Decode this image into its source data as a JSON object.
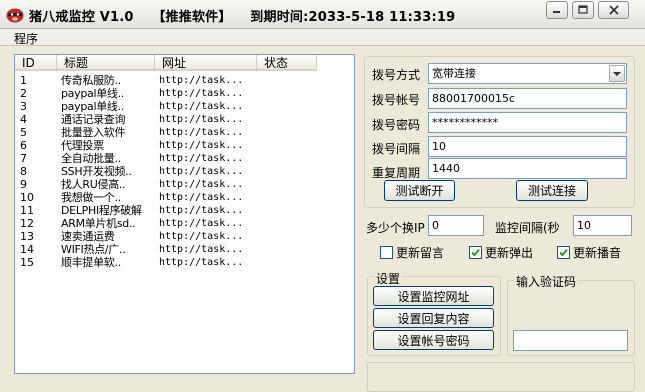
{
  "window": {
    "title": "猪八戒监控 V1.0",
    "tag": "【推推软件】",
    "expiry": "到期时间:2033-5-18 11:33:19"
  },
  "menu": {
    "program": "程序"
  },
  "table": {
    "headers": [
      "ID",
      "标题",
      "网址",
      "状态"
    ],
    "rows": [
      {
        "id": "1",
        "title": "传奇私服防..",
        "url": "http://task...",
        "status": ""
      },
      {
        "id": "2",
        "title": "paypal单线..",
        "url": "http://task...",
        "status": ""
      },
      {
        "id": "3",
        "title": "paypal单线..",
        "url": "http://task...",
        "status": ""
      },
      {
        "id": "4",
        "title": "通话记录查询",
        "url": "http://task...",
        "status": ""
      },
      {
        "id": "5",
        "title": "批量登入软件",
        "url": "http://task...",
        "status": ""
      },
      {
        "id": "6",
        "title": "代理投票",
        "url": "http://task...",
        "status": ""
      },
      {
        "id": "7",
        "title": "全自动批量..",
        "url": "http://task...",
        "status": ""
      },
      {
        "id": "8",
        "title": "SSH开发视频..",
        "url": "http://task...",
        "status": ""
      },
      {
        "id": "9",
        "title": "找人RU侵高..",
        "url": "http://task...",
        "status": ""
      },
      {
        "id": "10",
        "title": "我想做一个..",
        "url": "http://task...",
        "status": ""
      },
      {
        "id": "11",
        "title": "DELPHI程序破解",
        "url": "http://task...",
        "status": ""
      },
      {
        "id": "12",
        "title": "ARM单片机sd..",
        "url": "http://task...",
        "status": ""
      },
      {
        "id": "13",
        "title": "速卖通运费",
        "url": "http://task...",
        "status": ""
      },
      {
        "id": "14",
        "title": "WIFI热点/广..",
        "url": "http://task...",
        "status": ""
      },
      {
        "id": "15",
        "title": "顺丰提单软..",
        "url": "http://task...",
        "status": ""
      }
    ]
  },
  "dial": {
    "mode_label": "拨号方式",
    "mode_value": "宽带连接",
    "account_label": "拨号帐号",
    "account_value": "88001700015c",
    "password_label": "拨号密码",
    "password_value": "************",
    "interval_label": "拨号间隔",
    "interval_value": "10",
    "cycle_label": "重复周期",
    "cycle_value": "1440",
    "test_disconnect": "测试断开",
    "test_connect": "测试连接"
  },
  "monitor": {
    "ip_switch_label": "多少个换IP",
    "ip_switch_value": "0",
    "interval_label": "监控间隔(秒",
    "interval_value": "10",
    "update_message": "更新留言",
    "update_message_checked": false,
    "update_popup": "更新弹出",
    "update_popup_checked": true,
    "update_voice": "更新播音",
    "update_voice_checked": true
  },
  "settings": {
    "group_label": "设置",
    "monitor_url_button": "设置监控网址",
    "reply_content_button": "设置回复内容",
    "account_password_button": "设置帐号密码"
  },
  "captcha": {
    "label": "输入验证码",
    "value": ""
  },
  "icons": {
    "app": "pig-app-icon",
    "minimize": "minimize-icon",
    "maximize": "maximize-icon",
    "close": "close-icon",
    "dropdown": "chevron-down-icon",
    "check": "checkmark-icon"
  },
  "colors": {
    "window_bg": "#ece9d8",
    "border_blue": "#7f9db9",
    "button_border": "#003c74"
  }
}
